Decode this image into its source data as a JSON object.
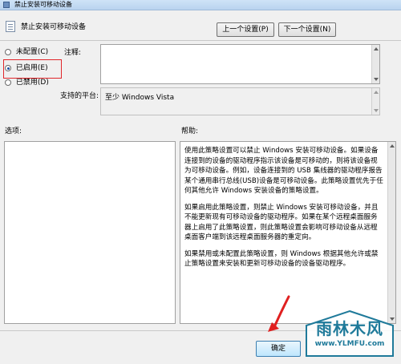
{
  "window": {
    "title": "禁止安装可移动设备"
  },
  "header": {
    "policy_title": "禁止安装可移动设备"
  },
  "nav": {
    "prev_label": "上一个设置(P)",
    "next_label": "下一个设置(N)"
  },
  "options": [
    {
      "label": "未配置(C)",
      "selected": false
    },
    {
      "label": "已启用(E)",
      "selected": true
    },
    {
      "label": "已禁用(D)",
      "selected": false
    }
  ],
  "comment": {
    "label": "注释:",
    "value": ""
  },
  "platform": {
    "label": "支持的平台:",
    "value": "至少 Windows Vista"
  },
  "options_section": {
    "label": "选项:"
  },
  "help_section": {
    "label": "帮助:",
    "paragraphs": [
      "使用此策略设置可以禁止 Windows 安装可移动设备。如果设备连接到的设备的驱动程序指示该设备是可移动的，则将该设备视为可移动设备。例如，设备连接到的 USB 集线器的驱动程序报告某个通用串行总线(USB)设备是可移动设备。此策略设置优先于任何其他允许 Windows 安装设备的策略设置。",
      "如果启用此策略设置，则禁止 Windows 安装可移动设备，并且不能更新现有可移动设备的驱动程序。如果在某个远程桌面服务器上启用了此策略设置，则此策略设置会影响可移动设备从远程桌面客户端到该远程桌面服务器的重定向。",
      "如果禁用或未配置此策略设置，则 Windows 根据其他允许或禁止策略设置来安装和更新可移动设备的设备驱动程序。"
    ]
  },
  "footer": {
    "ok_label": "确定"
  },
  "watermark": {
    "title": "雨林木风",
    "url": "www.YLMFU.com"
  }
}
